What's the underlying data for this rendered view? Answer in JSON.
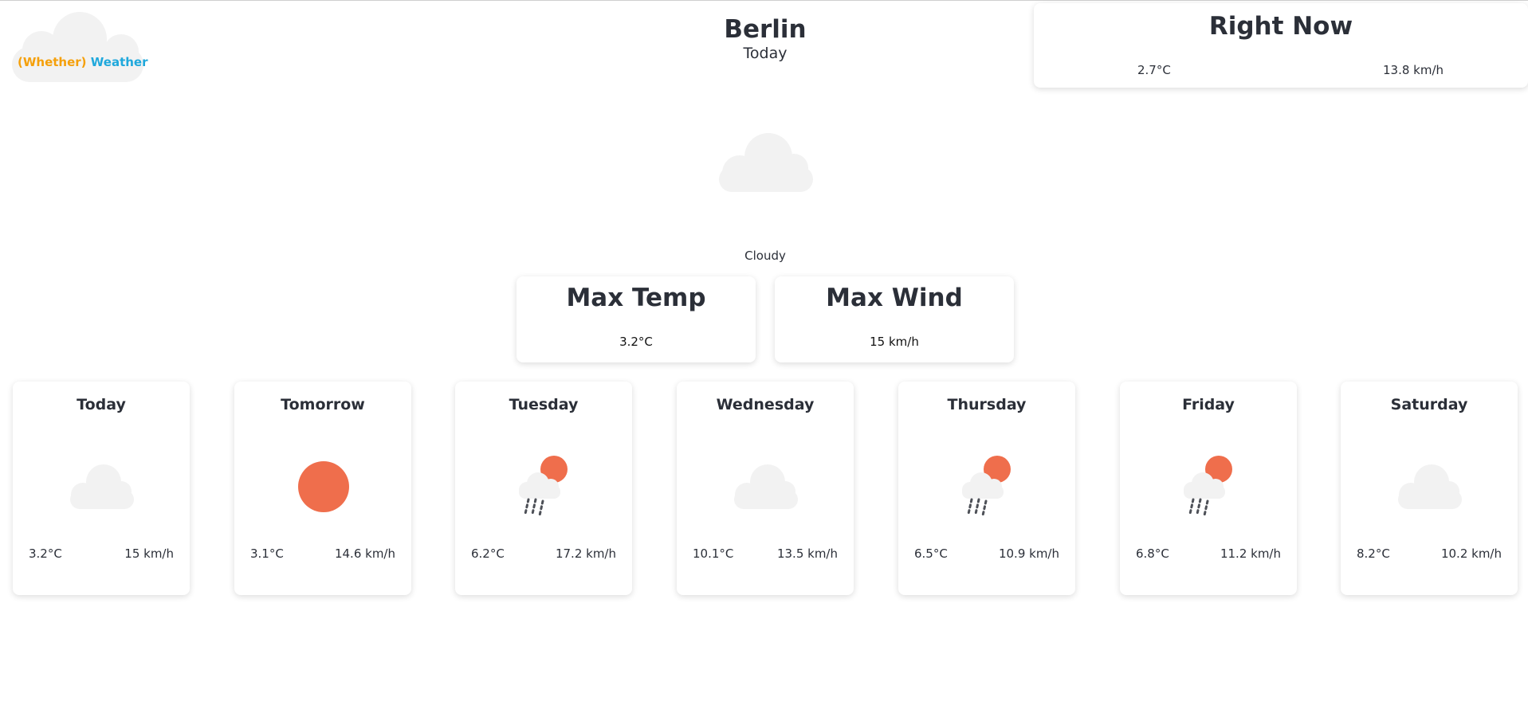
{
  "logo": {
    "part1": "(Whether)",
    "part2": "Weather"
  },
  "header": {
    "city": "Berlin",
    "subtitle": "Today"
  },
  "right_now": {
    "title": "Right Now",
    "temp": "2.7°C",
    "wind": "13.8 km/h"
  },
  "current": {
    "condition": "Cloudy"
  },
  "max_temp": {
    "title": "Max Temp",
    "value": "3.2°C"
  },
  "max_wind": {
    "title": "Max Wind",
    "value": "15 km/h"
  },
  "forecast": [
    {
      "day": "Today",
      "temp": "3.2°C",
      "wind": "15 km/h",
      "icon": "cloud-icon"
    },
    {
      "day": "Tomorrow",
      "temp": "3.1°C",
      "wind": "14.6 km/h",
      "icon": "sun-icon"
    },
    {
      "day": "Tuesday",
      "temp": "6.2°C",
      "wind": "17.2 km/h",
      "icon": "rain-sun-icon"
    },
    {
      "day": "Wednesday",
      "temp": "10.1°C",
      "wind": "13.5 km/h",
      "icon": "cloud-icon"
    },
    {
      "day": "Thursday",
      "temp": "6.5°C",
      "wind": "10.9 km/h",
      "icon": "rain-sun-icon"
    },
    {
      "day": "Friday",
      "temp": "6.8°C",
      "wind": "11.2 km/h",
      "icon": "rain-sun-icon"
    },
    {
      "day": "Saturday",
      "temp": "8.2°C",
      "wind": "10.2 km/h",
      "icon": "cloud-icon"
    }
  ],
  "colors": {
    "cloud": "#f2f2f2",
    "sun": "#ef6e4c",
    "rain": "#4d5057",
    "brand_orange": "#f5a00b",
    "brand_blue": "#1fa8dc"
  }
}
